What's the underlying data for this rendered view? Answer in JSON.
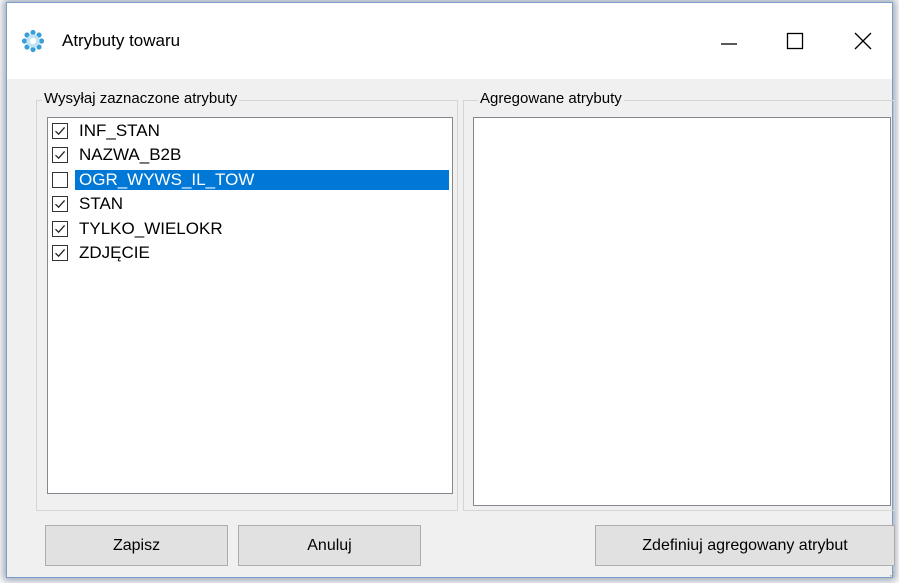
{
  "window": {
    "title": "Atrybuty towaru",
    "icon": "app-gear-icon",
    "controls": [
      "minimize-icon",
      "maximize-icon",
      "close-icon"
    ]
  },
  "left_group": {
    "label": "Wysyłaj zaznaczone atrybuty",
    "items": [
      {
        "label": "INF_STAN",
        "checked": true,
        "selected": false
      },
      {
        "label": "NAZWA_B2B",
        "checked": true,
        "selected": false
      },
      {
        "label": "OGR_WYWS_IL_TOW",
        "checked": false,
        "selected": true
      },
      {
        "label": "STAN",
        "checked": true,
        "selected": false
      },
      {
        "label": "TYLKO_WIELOKR",
        "checked": true,
        "selected": false
      },
      {
        "label": "ZDJĘCIE",
        "checked": true,
        "selected": false
      }
    ]
  },
  "right_group": {
    "label": "Agregowane atrybuty",
    "items": []
  },
  "buttons": {
    "save": "Zapisz",
    "cancel": "Anuluj",
    "define": "Zdefiniuj agregowany atrybut"
  },
  "colors": {
    "selection": "#0078d7",
    "window_border": "#7a9ecb",
    "icon_accent": "#3a9fd8"
  }
}
